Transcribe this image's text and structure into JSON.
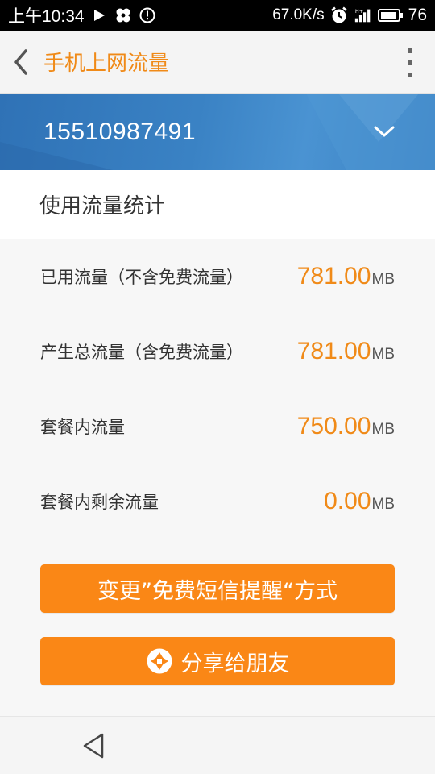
{
  "status_bar": {
    "time": "上午10:34",
    "speed": "67.0K/s",
    "battery": "76",
    "icons": [
      "play-icon",
      "pinwheel-icon",
      "alert-icon",
      "alarm-icon",
      "signal-icon",
      "battery-icon"
    ]
  },
  "app_bar": {
    "title": "手机上网流量",
    "back_icon": "chevron-left-icon",
    "menu_icon": "more-vertical-icon"
  },
  "account": {
    "phone_number": "15510987491",
    "dropdown_icon": "chevron-down-icon"
  },
  "usage": {
    "section_title": "使用流量统计",
    "rows": [
      {
        "label": "已用流量（不含免费流量）",
        "value": "781.00",
        "unit": "MB"
      },
      {
        "label": "产生总流量（含免费流量）",
        "value": "781.00",
        "unit": "MB"
      },
      {
        "label": "套餐内流量",
        "value": "750.00",
        "unit": "MB"
      },
      {
        "label": "套餐内剩余流量",
        "value": "0.00",
        "unit": "MB"
      }
    ]
  },
  "actions": {
    "change_reminder": "变更”免费短信提醒“方式",
    "share": "分享给朋友",
    "share_icon": "shutter-icon"
  },
  "colors": {
    "accent": "#f08a18",
    "button": "#fa8716",
    "banner": "#3a80c2"
  }
}
